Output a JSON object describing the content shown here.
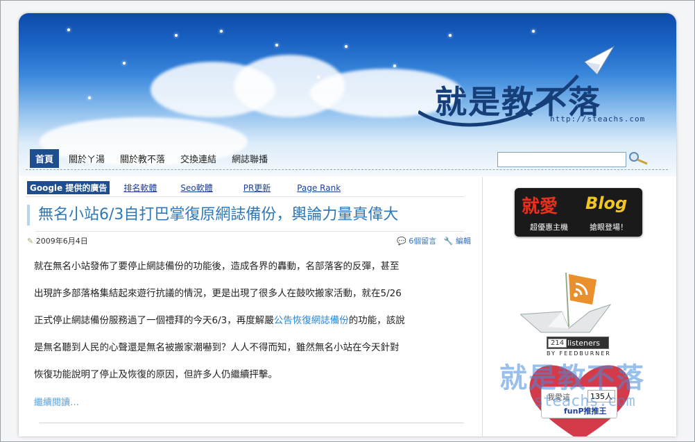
{
  "site": {
    "logo_text": "就是教不落",
    "url_text": "http://steachs.com"
  },
  "nav": {
    "items": [
      {
        "label": "首頁",
        "active": true
      },
      {
        "label": "關於ㄚ湯"
      },
      {
        "label": "關於教不落"
      },
      {
        "label": "交換連結"
      },
      {
        "label": "網誌聯播"
      }
    ],
    "search_placeholder": ""
  },
  "ads": {
    "label": "Google 提供的廣告",
    "links": [
      "排名軟體",
      "Seo軟體",
      "PR更新",
      "Page Rank"
    ]
  },
  "post": {
    "title": "無名小站6/3自打巴掌復原網誌備份，輿論力量真偉大",
    "date": "2009年6月4日",
    "comments": "6個留言",
    "edit": "編輯",
    "p1": "就在無名小站發佈了要停止網誌備份的功能後，造成各界的轟動，名部落客的反彈，甚至",
    "p2": "出現許多部落格集結起來遊行抗議的情況，更是出現了很多人在鼓吹搬家活動，就在5/26",
    "p3a": "正式停止網誌備份服務過了一個禮拜的今天6/3，再度解嚴",
    "p3link": "公告恢復網誌備份",
    "p3b": "的功能，該說",
    "p4": "是無名聽到人民的心聲還是無名被搬家潮嚇到？人人不得而知，雖然無名小站在今天針對",
    "p5": "恢復功能說明了停止及恢復的原因，但許多人仍繼續抨擊。",
    "more": "繼續閱讀…"
  },
  "sidebar": {
    "banner_t1": "就愛",
    "banner_t2": "Blog",
    "banner_t3": "超優惠主機",
    "banner_t4": "搶眼登場！",
    "feed_count": "214",
    "feed_label": "listeners",
    "feed_by": "BY FEEDBURNER",
    "funp_label": "我愛這",
    "funp_count": "135人",
    "funp_brand": "funP推推王"
  },
  "watermark": {
    "text": "就是教不落",
    "url": "steachs.com"
  },
  "colors": {
    "nav_active": "#1f4e8f",
    "title": "#2f78b8",
    "link": "#2f86cf"
  }
}
